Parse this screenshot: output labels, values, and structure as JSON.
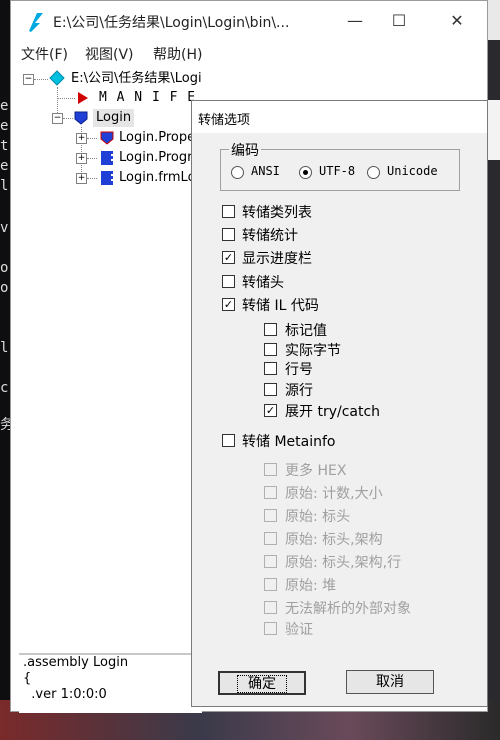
{
  "window": {
    "title": "E:\\公司\\任务结果\\Login\\Login\\bin\\...",
    "minimize_symbol": "—",
    "maximize_symbol": "☐",
    "close_symbol": "✕"
  },
  "menu": [
    "文件(F)",
    "视图(V)",
    "帮助(H)"
  ],
  "tree": {
    "root": "E:\\公司\\任务结果\\Login\\Login\\bin\\Debug\\Login.exe",
    "manifest": "M A N I F E S T",
    "login": "Login",
    "children": [
      "Login.Propert",
      "Login.Program",
      "Login.frmLogi"
    ]
  },
  "il_pane": [
    ".assembly Login",
    "{",
    "  .ver 1:0:0:0"
  ],
  "dialog": {
    "title": "转储选项",
    "encoding_group": "编码",
    "encodings": [
      {
        "label": "ANSI",
        "selected": false
      },
      {
        "label": "UTF-8",
        "selected": true
      },
      {
        "label": "Unicode",
        "selected": false
      }
    ],
    "options": [
      {
        "label": "转储类列表",
        "checked": false,
        "enabled": true
      },
      {
        "label": "转储统计",
        "checked": false,
        "enabled": true
      },
      {
        "label": "显示进度栏",
        "checked": true,
        "enabled": true
      },
      {
        "label": "转储头",
        "checked": false,
        "enabled": true
      },
      {
        "label": "转储 IL 代码",
        "checked": true,
        "enabled": true
      }
    ],
    "il_options": [
      {
        "label": "标记值",
        "checked": false,
        "enabled": true
      },
      {
        "label": "实际字节",
        "checked": false,
        "enabled": true
      },
      {
        "label": "行号",
        "checked": false,
        "enabled": true
      },
      {
        "label": "源行",
        "checked": false,
        "enabled": true
      },
      {
        "label": "展开 try/catch",
        "checked": true,
        "enabled": true
      }
    ],
    "metainfo": {
      "label": "转储 Metainfo",
      "checked": false,
      "enabled": true
    },
    "meta_options": [
      {
        "label": "更多 HEX",
        "checked": false,
        "enabled": false
      },
      {
        "label": "原始: 计数,大小",
        "checked": false,
        "enabled": false
      },
      {
        "label": "原始: 标头",
        "checked": false,
        "enabled": false
      },
      {
        "label": "原始: 标头,架构",
        "checked": false,
        "enabled": false
      },
      {
        "label": "原始: 标头,架构,行",
        "checked": false,
        "enabled": false
      },
      {
        "label": "原始: 堆",
        "checked": false,
        "enabled": false
      },
      {
        "label": "无法解析的外部对象",
        "checked": false,
        "enabled": false
      },
      {
        "label": "验证",
        "checked": false,
        "enabled": false
      }
    ],
    "ok_label": "确定",
    "cancel_label": "取消"
  },
  "colors": {
    "accent_cyan": "#00b4d8",
    "manifest_red": "#d00000",
    "class_blue": "#1f3fd6"
  }
}
